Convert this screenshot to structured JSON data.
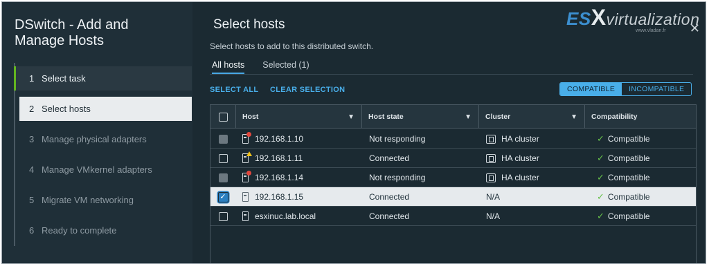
{
  "wizard": {
    "title": "DSwitch - Add and Manage Hosts",
    "steps": [
      {
        "num": "1",
        "label": "Select task"
      },
      {
        "num": "2",
        "label": "Select hosts"
      },
      {
        "num": "3",
        "label": "Manage physical adapters"
      },
      {
        "num": "4",
        "label": "Manage VMkernel adapters"
      },
      {
        "num": "5",
        "label": "Migrate VM networking"
      },
      {
        "num": "6",
        "label": "Ready to complete"
      }
    ]
  },
  "page": {
    "title": "Select hosts",
    "subtitle": "Select hosts to add to this distributed switch.",
    "close_icon": "close-icon",
    "logo": {
      "es": "ES",
      "x": "X",
      "rest": "virtualization",
      "url": "www.vladan.fr"
    }
  },
  "tabs": [
    {
      "label": "All hosts",
      "active": true
    },
    {
      "label": "Selected (1)",
      "active": false
    }
  ],
  "actions": {
    "select_all": "SELECT ALL",
    "clear_selection": "CLEAR SELECTION"
  },
  "filter_toggle": {
    "compatible": "COMPATIBLE",
    "incompatible": "INCOMPATIBLE",
    "selected": "compatible"
  },
  "grid": {
    "columns": [
      "Host",
      "Host state",
      "Cluster",
      "Compatibility"
    ],
    "rows": [
      {
        "host": "192.168.1.10",
        "state": "Not responding",
        "cluster": "HA cluster",
        "compat": "Compatible",
        "checkbox": "disabled",
        "status": "error"
      },
      {
        "host": "192.168.1.11",
        "state": "Connected",
        "cluster": "HA cluster",
        "compat": "Compatible",
        "checkbox": "unchecked",
        "status": "warning"
      },
      {
        "host": "192.168.1.14",
        "state": "Not responding",
        "cluster": "HA cluster",
        "compat": "Compatible",
        "checkbox": "disabled",
        "status": "error"
      },
      {
        "host": "192.168.1.15",
        "state": "Connected",
        "cluster": "N/A",
        "compat": "Compatible",
        "checkbox": "checked",
        "status": "ok"
      },
      {
        "host": "esxinuc.lab.local",
        "state": "Connected",
        "cluster": "N/A",
        "compat": "Compatible",
        "checkbox": "unchecked",
        "status": "ok"
      }
    ]
  },
  "colors": {
    "accent": "#49aee9",
    "active_step": "#63b520",
    "compatible": "#67c04a",
    "error": "#e2463c",
    "warning": "#f4c21a"
  }
}
